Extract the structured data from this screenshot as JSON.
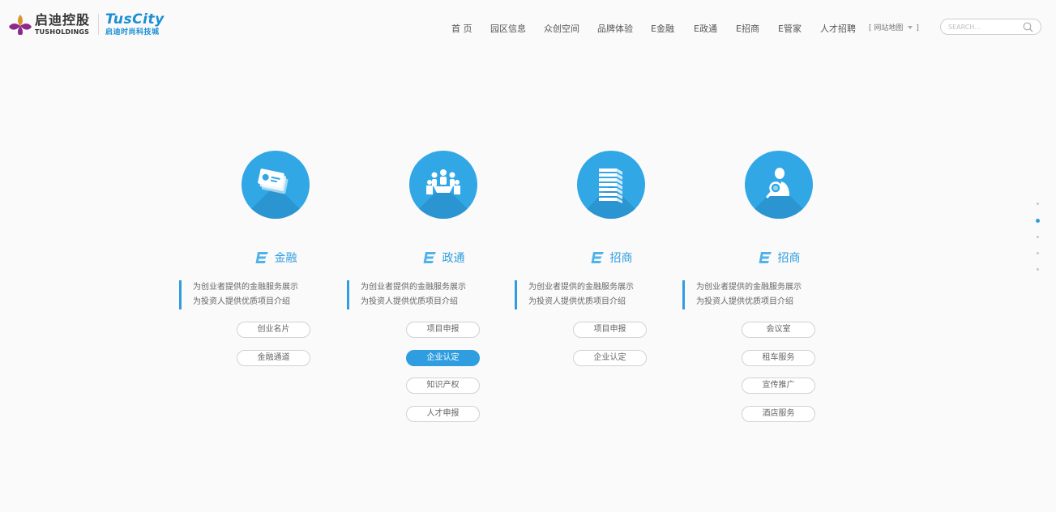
{
  "brand": {
    "tus_cn": "启迪控股",
    "tus_en": "TUSHOLDINGS",
    "city_en": "TusCity",
    "city_cn": "启迪时尚科技城",
    "primary_color": "#31a7e6",
    "emblem_color": "#8b2a8a"
  },
  "nav": {
    "items": [
      "首 页",
      "园区信息",
      "众创空间",
      "品牌体验",
      "E金融",
      "E政通",
      "E招商",
      "E管家",
      "人才招聘"
    ],
    "sitemap_label": "[ 网站地图",
    "sitemap_close": "]"
  },
  "search": {
    "placeholder": "SEARCH..."
  },
  "cards": [
    {
      "icon": "credit-cards-icon",
      "title": "金融",
      "desc": [
        "为创业者提供的金融服务展示",
        "为投资人提供优质项目介绍"
      ],
      "buttons": [
        "创业名片",
        "金融通道"
      ]
    },
    {
      "icon": "meeting-icon",
      "title": "政通",
      "desc": [
        "为创业者提供的金融服务展示",
        "为投资人提供优质项目介绍"
      ],
      "buttons": [
        "项目申报",
        "企业认定",
        "知识产权",
        "人才申报"
      ]
    },
    {
      "icon": "building-icon",
      "title": "招商",
      "desc": [
        "为创业者提供的金融服务展示",
        "为投资人提供优质项目介绍"
      ],
      "buttons": [
        "项目申报",
        "企业认定"
      ]
    },
    {
      "icon": "business-person-icon",
      "title": "招商",
      "desc": [
        "为创业者提供的金融服务展示",
        "为投资人提供优质项目介绍"
      ],
      "buttons": [
        "会议室",
        "租车服务",
        "宣传推广",
        "酒店服务"
      ]
    }
  ],
  "active_button": "企业认定",
  "side_dots": {
    "count": 5,
    "active_index": 1
  }
}
